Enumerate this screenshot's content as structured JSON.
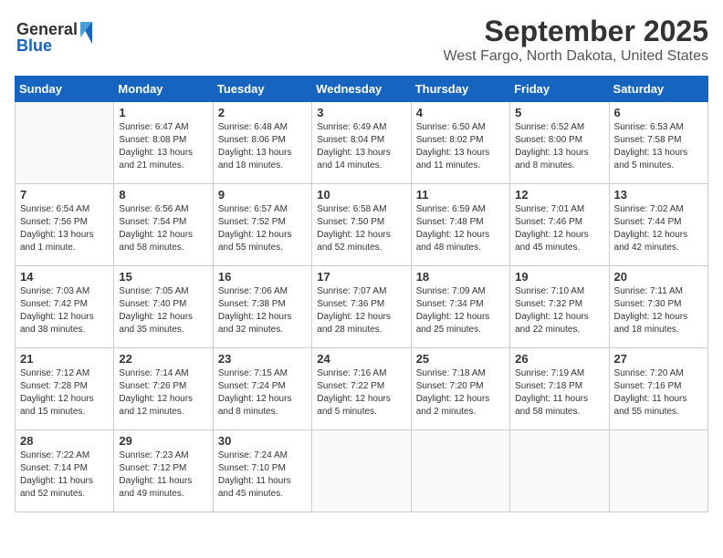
{
  "header": {
    "logo_line1": "General",
    "logo_line2": "Blue",
    "month": "September 2025",
    "location": "West Fargo, North Dakota, United States"
  },
  "weekdays": [
    "Sunday",
    "Monday",
    "Tuesday",
    "Wednesday",
    "Thursday",
    "Friday",
    "Saturday"
  ],
  "weeks": [
    [
      {
        "day": "",
        "info": ""
      },
      {
        "day": "1",
        "info": "Sunrise: 6:47 AM\nSunset: 8:08 PM\nDaylight: 13 hours\nand 21 minutes."
      },
      {
        "day": "2",
        "info": "Sunrise: 6:48 AM\nSunset: 8:06 PM\nDaylight: 13 hours\nand 18 minutes."
      },
      {
        "day": "3",
        "info": "Sunrise: 6:49 AM\nSunset: 8:04 PM\nDaylight: 13 hours\nand 14 minutes."
      },
      {
        "day": "4",
        "info": "Sunrise: 6:50 AM\nSunset: 8:02 PM\nDaylight: 13 hours\nand 11 minutes."
      },
      {
        "day": "5",
        "info": "Sunrise: 6:52 AM\nSunset: 8:00 PM\nDaylight: 13 hours\nand 8 minutes."
      },
      {
        "day": "6",
        "info": "Sunrise: 6:53 AM\nSunset: 7:58 PM\nDaylight: 13 hours\nand 5 minutes."
      }
    ],
    [
      {
        "day": "7",
        "info": "Sunrise: 6:54 AM\nSunset: 7:56 PM\nDaylight: 13 hours\nand 1 minute."
      },
      {
        "day": "8",
        "info": "Sunrise: 6:56 AM\nSunset: 7:54 PM\nDaylight: 12 hours\nand 58 minutes."
      },
      {
        "day": "9",
        "info": "Sunrise: 6:57 AM\nSunset: 7:52 PM\nDaylight: 12 hours\nand 55 minutes."
      },
      {
        "day": "10",
        "info": "Sunrise: 6:58 AM\nSunset: 7:50 PM\nDaylight: 12 hours\nand 52 minutes."
      },
      {
        "day": "11",
        "info": "Sunrise: 6:59 AM\nSunset: 7:48 PM\nDaylight: 12 hours\nand 48 minutes."
      },
      {
        "day": "12",
        "info": "Sunrise: 7:01 AM\nSunset: 7:46 PM\nDaylight: 12 hours\nand 45 minutes."
      },
      {
        "day": "13",
        "info": "Sunrise: 7:02 AM\nSunset: 7:44 PM\nDaylight: 12 hours\nand 42 minutes."
      }
    ],
    [
      {
        "day": "14",
        "info": "Sunrise: 7:03 AM\nSunset: 7:42 PM\nDaylight: 12 hours\nand 38 minutes."
      },
      {
        "day": "15",
        "info": "Sunrise: 7:05 AM\nSunset: 7:40 PM\nDaylight: 12 hours\nand 35 minutes."
      },
      {
        "day": "16",
        "info": "Sunrise: 7:06 AM\nSunset: 7:38 PM\nDaylight: 12 hours\nand 32 minutes."
      },
      {
        "day": "17",
        "info": "Sunrise: 7:07 AM\nSunset: 7:36 PM\nDaylight: 12 hours\nand 28 minutes."
      },
      {
        "day": "18",
        "info": "Sunrise: 7:09 AM\nSunset: 7:34 PM\nDaylight: 12 hours\nand 25 minutes."
      },
      {
        "day": "19",
        "info": "Sunrise: 7:10 AM\nSunset: 7:32 PM\nDaylight: 12 hours\nand 22 minutes."
      },
      {
        "day": "20",
        "info": "Sunrise: 7:11 AM\nSunset: 7:30 PM\nDaylight: 12 hours\nand 18 minutes."
      }
    ],
    [
      {
        "day": "21",
        "info": "Sunrise: 7:12 AM\nSunset: 7:28 PM\nDaylight: 12 hours\nand 15 minutes."
      },
      {
        "day": "22",
        "info": "Sunrise: 7:14 AM\nSunset: 7:26 PM\nDaylight: 12 hours\nand 12 minutes."
      },
      {
        "day": "23",
        "info": "Sunrise: 7:15 AM\nSunset: 7:24 PM\nDaylight: 12 hours\nand 8 minutes."
      },
      {
        "day": "24",
        "info": "Sunrise: 7:16 AM\nSunset: 7:22 PM\nDaylight: 12 hours\nand 5 minutes."
      },
      {
        "day": "25",
        "info": "Sunrise: 7:18 AM\nSunset: 7:20 PM\nDaylight: 12 hours\nand 2 minutes."
      },
      {
        "day": "26",
        "info": "Sunrise: 7:19 AM\nSunset: 7:18 PM\nDaylight: 11 hours\nand 58 minutes."
      },
      {
        "day": "27",
        "info": "Sunrise: 7:20 AM\nSunset: 7:16 PM\nDaylight: 11 hours\nand 55 minutes."
      }
    ],
    [
      {
        "day": "28",
        "info": "Sunrise: 7:22 AM\nSunset: 7:14 PM\nDaylight: 11 hours\nand 52 minutes."
      },
      {
        "day": "29",
        "info": "Sunrise: 7:23 AM\nSunset: 7:12 PM\nDaylight: 11 hours\nand 49 minutes."
      },
      {
        "day": "30",
        "info": "Sunrise: 7:24 AM\nSunset: 7:10 PM\nDaylight: 11 hours\nand 45 minutes."
      },
      {
        "day": "",
        "info": ""
      },
      {
        "day": "",
        "info": ""
      },
      {
        "day": "",
        "info": ""
      },
      {
        "day": "",
        "info": ""
      }
    ]
  ]
}
